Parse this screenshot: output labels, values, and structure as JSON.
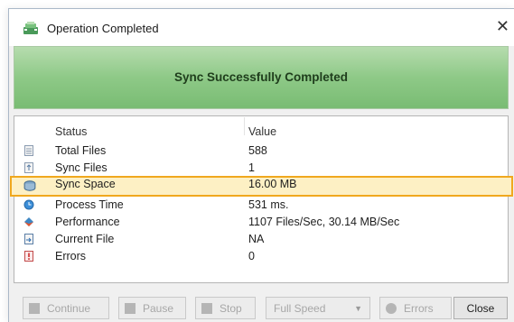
{
  "window": {
    "title": "Operation Completed",
    "close_glyph": "✕"
  },
  "banner": {
    "text": "Sync Successfully Completed",
    "color": "#8ec987"
  },
  "table": {
    "headers": [
      "Status",
      "Value"
    ],
    "rows": [
      {
        "name": "Total Files",
        "value": "588",
        "icon": "document-icon",
        "selected": false
      },
      {
        "name": "Sync Files",
        "value": "1",
        "icon": "sync-document-icon",
        "selected": false
      },
      {
        "name": "Sync Space",
        "value": "16.00 MB",
        "icon": "disk-icon",
        "selected": true
      },
      {
        "name": "Process Time",
        "value": "531 ms.",
        "icon": "clock-icon",
        "selected": false
      },
      {
        "name": "Performance",
        "value": "1107 Files/Sec, 30.14 MB/Sec",
        "icon": "performance-icon",
        "selected": false
      },
      {
        "name": "Current File",
        "value": "NA",
        "icon": "file-arrow-icon",
        "selected": false
      },
      {
        "name": "Errors",
        "value": "0",
        "icon": "error-icon",
        "selected": false
      }
    ],
    "selection_color": "#f0a81e"
  },
  "buttons": {
    "continue": "Continue",
    "pause": "Pause",
    "stop": "Stop",
    "speed": "Full Speed",
    "errors": "Errors",
    "close": "Close"
  }
}
